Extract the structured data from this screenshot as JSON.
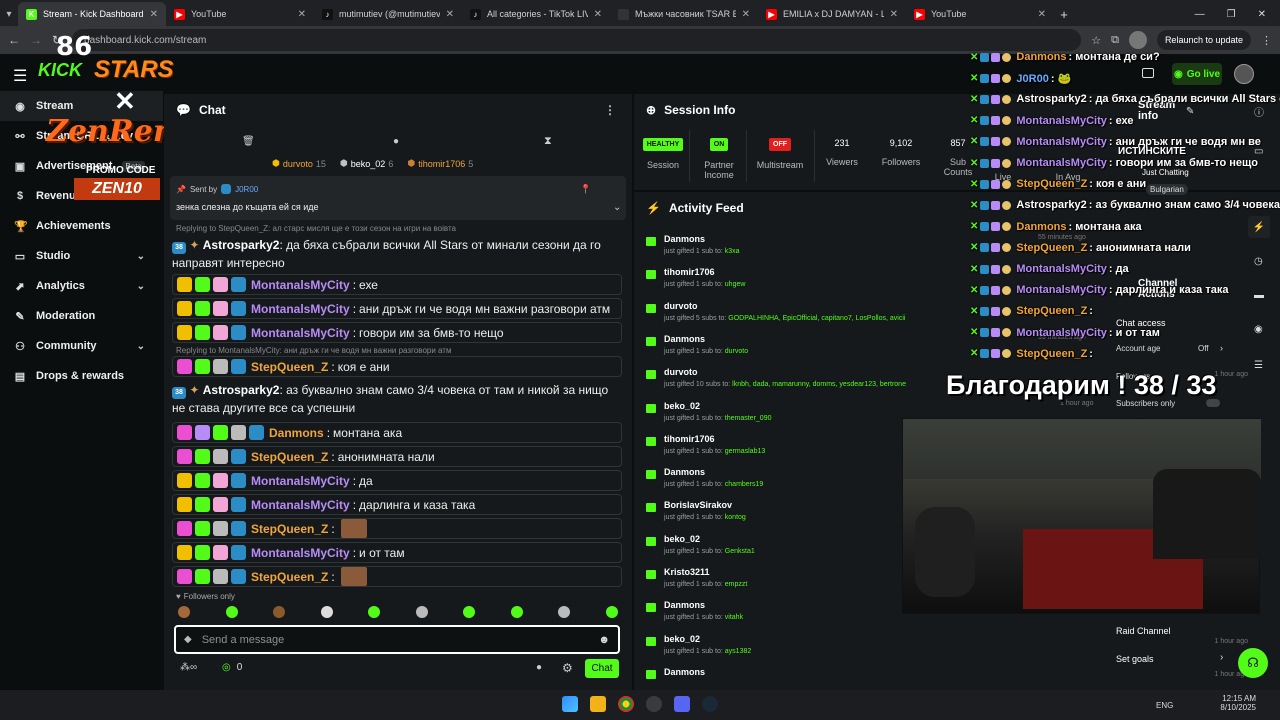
{
  "browser": {
    "tabs": [
      {
        "title": "Stream - Kick Dashboard",
        "color": "#53fc18",
        "glyph": "K"
      },
      {
        "title": "YouTube",
        "color": "#ff0000",
        "glyph": "▶"
      },
      {
        "title": "mutimutiev (@mutimutiev) is L",
        "color": "#111111",
        "glyph": "♪"
      },
      {
        "title": "All categories - TikTok LIVE",
        "color": "#111111",
        "glyph": "♪"
      },
      {
        "title": "Мъжки часовник TSAR BOMB",
        "color": "#333333",
        "glyph": ""
      },
      {
        "title": "EMILIA x DJ DAMYAN - LUD SK",
        "color": "#ff0000",
        "glyph": "▶"
      },
      {
        "title": "YouTube",
        "color": "#ff0000",
        "glyph": "▶"
      }
    ],
    "url": "dashboard.kick.com/stream",
    "relaunch_label": "Relaunch to update"
  },
  "overlay_logo": {
    "kick": "KICK",
    "stars": "STARS",
    "brand": "ZenRemasta",
    "promo_label": "PROMO CODE",
    "promo_code": "ZEN10"
  },
  "header": {
    "go_live_label": "Go live"
  },
  "sidebar": {
    "items": [
      {
        "label": "Stream",
        "icon": "broadcast-icon"
      },
      {
        "label": "Stream URL & Key",
        "icon": "link-icon"
      },
      {
        "label": "Advertisement",
        "icon": "ad-icon",
        "badge": "Beta"
      },
      {
        "label": "Revenue",
        "icon": "dollar-icon"
      },
      {
        "label": "Achievements",
        "icon": "trophy-icon"
      },
      {
        "label": "Studio",
        "icon": "monitor-icon"
      },
      {
        "label": "Analytics",
        "icon": "chart-icon"
      },
      {
        "label": "Moderation",
        "icon": "wrench-icon"
      },
      {
        "label": "Community",
        "icon": "people-icon"
      },
      {
        "label": "Drops & rewards",
        "icon": "gift-icon"
      }
    ]
  },
  "chat": {
    "title": "Chat",
    "leaderboard": [
      {
        "name": "durvoto",
        "count": "15"
      },
      {
        "name": "beko_02",
        "count": "6"
      },
      {
        "name": "tihomir1706",
        "count": "5"
      }
    ],
    "pinned": {
      "sent_by_label": "Sent by",
      "sender": "J0R00",
      "text": "зенка слезна до къщата ей ся иде"
    },
    "reply_top": "Replying to StepQueen_Z: ал старс мисля ще е този сезон на игри на воівта",
    "messages": [
      {
        "user": "Astrosparky2",
        "color": "white",
        "text": "да бяха събрали всички All Stars от минали сезони да го направят интересно",
        "level": "38"
      },
      {
        "user": "MontanalsMyCity",
        "color": "purple",
        "text": "ехе"
      },
      {
        "user": "MontanalsMyCity",
        "color": "purple",
        "text": "ани дръж ги че водя мн важни разговори атм"
      },
      {
        "user": "MontanalsMyCity",
        "color": "purple",
        "text": "говори им за бмв-то нещо"
      },
      {
        "user": "StepQueen_Z",
        "color": "orange",
        "text": "коя е ани",
        "reply": "Replying to MontanalsMyCity: ани дръж ги че водя мн важни разговори атм"
      },
      {
        "user": "Astrosparky2",
        "color": "white",
        "text": "аз буквално знам само 3/4 човека от там и никой за нищо не става другите все са успешни",
        "level": "38"
      },
      {
        "user": "Danmons",
        "color": "orange",
        "text": "монтана ака"
      },
      {
        "user": "StepQueen_Z",
        "color": "orange",
        "text": "анонимната нали"
      },
      {
        "user": "MontanalsMyCity",
        "color": "purple",
        "text": "да"
      },
      {
        "user": "MontanalsMyCity",
        "color": "purple",
        "text": "дарлинга и каза така"
      },
      {
        "user": "StepQueen_Z",
        "color": "orange",
        "text": ""
      },
      {
        "user": "MontanalsMyCity",
        "color": "purple",
        "text": "и от там"
      },
      {
        "user": "StepQueen_Z",
        "color": "orange",
        "text": ""
      }
    ],
    "followers_only": "Followers only",
    "input_placeholder": "Send a message",
    "points": "0",
    "send_label": "Chat"
  },
  "session": {
    "title": "Session Info",
    "session_pill": "HEALTHY",
    "session_label": "Session",
    "partner_pill": "ON",
    "partner_label_1": "Partner",
    "partner_label_2": "Income",
    "multistream_pill": "OFF",
    "multistream_label": "Multistream",
    "viewers_value": "231",
    "viewers_label": "Viewers",
    "followers_value": "9,102",
    "followers_label": "Followers",
    "subs_value": "857",
    "subs_label_1": "Sub",
    "subs_label_2": "Counts",
    "live_label": "Live",
    "avg_label": "In Avg"
  },
  "activity": {
    "title": "Activity Feed",
    "items": [
      {
        "name": "Danmons",
        "count": "1",
        "unit": "sub",
        "to": "k3xa",
        "time": ""
      },
      {
        "name": "tihomir1706",
        "count": "1",
        "unit": "sub",
        "to": "uhgew",
        "time": ""
      },
      {
        "name": "durvoto",
        "count": "5",
        "unit": "subs",
        "to": "GODPALHINHA, EpicOfficial, capitano7, LosPollos, avicii",
        "time": ""
      },
      {
        "name": "Danmons",
        "count": "1",
        "unit": "sub",
        "to": "durvoto",
        "time": ""
      },
      {
        "name": "durvoto",
        "count": "10",
        "unit": "subs",
        "to": "lknbh, dada, mamarunny, domms, yesdear123, bertrone",
        "time": "1 hour ago"
      },
      {
        "name": "beko_02",
        "count": "1",
        "unit": "sub",
        "to": "themaster_090",
        "time": ""
      },
      {
        "name": "tihomir1706",
        "count": "1",
        "unit": "sub",
        "to": "germaslab13",
        "time": ""
      },
      {
        "name": "Danmons",
        "count": "1",
        "unit": "sub",
        "to": "chambers19",
        "time": ""
      },
      {
        "name": "BorislavSirakov",
        "count": "1",
        "unit": "sub",
        "to": "kontog",
        "time": ""
      },
      {
        "name": "beko_02",
        "count": "1",
        "unit": "sub",
        "to": "Genksta1",
        "time": ""
      },
      {
        "name": "Kristo3211",
        "count": "1",
        "unit": "sub",
        "to": "empzzt",
        "time": ""
      },
      {
        "name": "Danmons",
        "count": "1",
        "unit": "sub",
        "to": "vitahk",
        "time": ""
      },
      {
        "name": "beko_02",
        "count": "1",
        "unit": "sub",
        "to": "ays1382",
        "time": "1 hour ago"
      },
      {
        "name": "Danmons",
        "count": "",
        "unit": "",
        "to": "",
        "time": "1 hour ago"
      }
    ],
    "just_gifted": "just gifted",
    "to_label": "to:",
    "time_55": "55 minutes ago",
    "time_59": "59 minutes ago",
    "time_1h": "1 hour ago"
  },
  "stream_info": {
    "title": "Stream info",
    "category": "Just Chatting",
    "language": "Bulgarian",
    "channel_actions": "Channel Actions",
    "chat_access": "Chat access",
    "account_age": "Account age",
    "account_age_value": "Off",
    "followers": "Followers...",
    "subscribers_only": "Subscribers only",
    "raid": "Raid Channel",
    "goals": "Set goals"
  },
  "overlay_chat": [
    {
      "user": "Danmons",
      "color": "#f0a53a",
      "text": ": монтана де си?"
    },
    {
      "user": "J0R00",
      "color": "#6aa9ff",
      "text": ": 🐸"
    },
    {
      "user": "Astrosparky2",
      "color": "#ffffff",
      "text": ": да бяха събрали всички All Stars от"
    },
    {
      "user": "MontanalsMyCity",
      "color": "#b78cf7",
      "text": ": ехе"
    },
    {
      "user": "MontanalsMyCity",
      "color": "#b78cf7",
      "text": ": ани дръж ги че водя мн ве"
    },
    {
      "user": "MontanalsMyCity",
      "color": "#b78cf7",
      "text": ": говори им за бмв-то нещо"
    },
    {
      "user": "StepQueen_Z",
      "color": "#f0a53a",
      "text": ": коя е ани"
    },
    {
      "user": "Astrosparky2",
      "color": "#ffffff",
      "text": ": аз буквално знам само 3/4 човека"
    },
    {
      "user": "Danmons",
      "color": "#f0a53a",
      "text": ": монтана ака"
    },
    {
      "user": "StepQueen_Z",
      "color": "#f0a53a",
      "text": ": анонимната нали"
    },
    {
      "user": "MontanalsMyCity",
      "color": "#b78cf7",
      "text": ": да"
    },
    {
      "user": "MontanalsMyCity",
      "color": "#b78cf7",
      "text": ": дарлинга и каза така"
    },
    {
      "user": "StepQueen_Z",
      "color": "#f0a53a",
      "text": ":"
    },
    {
      "user": "MontanalsMyCity",
      "color": "#b78cf7",
      "text": ": и от там"
    },
    {
      "user": "StepQueen_Z",
      "color": "#f0a53a",
      "text": ":"
    }
  ],
  "overlay_thanks": "Благодарим ! 38 / 33",
  "overlay_istinskite": "ИСТИНСКИТЕ",
  "taskbar": {
    "lang": "ENG",
    "time": "12:15 AM",
    "date": "8/10/2025"
  }
}
